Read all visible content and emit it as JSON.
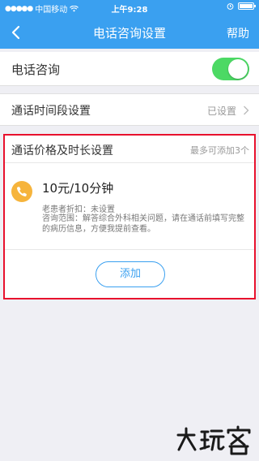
{
  "status_bar": {
    "carrier": "中国移动",
    "time": "上午9:28"
  },
  "nav": {
    "title": "电话咨询设置",
    "help_label": "帮助"
  },
  "phone_consult": {
    "label": "电话咨询",
    "enabled": true
  },
  "time_slot": {
    "label": "通话时间段设置",
    "value": "已设置"
  },
  "price_section": {
    "title": "通话价格及时长设置",
    "hint": "最多可添加3个",
    "items": [
      {
        "price": "10元/10分钟",
        "discount": "老患者折扣：未设置",
        "description": "咨询范围：解答综合外科相关问题，请在通话前填写完整的病历信息，方便我提前查看。"
      }
    ],
    "add_label": "添加"
  },
  "colors": {
    "brand_blue": "#3aa0f0",
    "toggle_green": "#4cd964",
    "phone_icon_orange": "#f6b43c",
    "highlight_red": "#e8112d"
  }
}
